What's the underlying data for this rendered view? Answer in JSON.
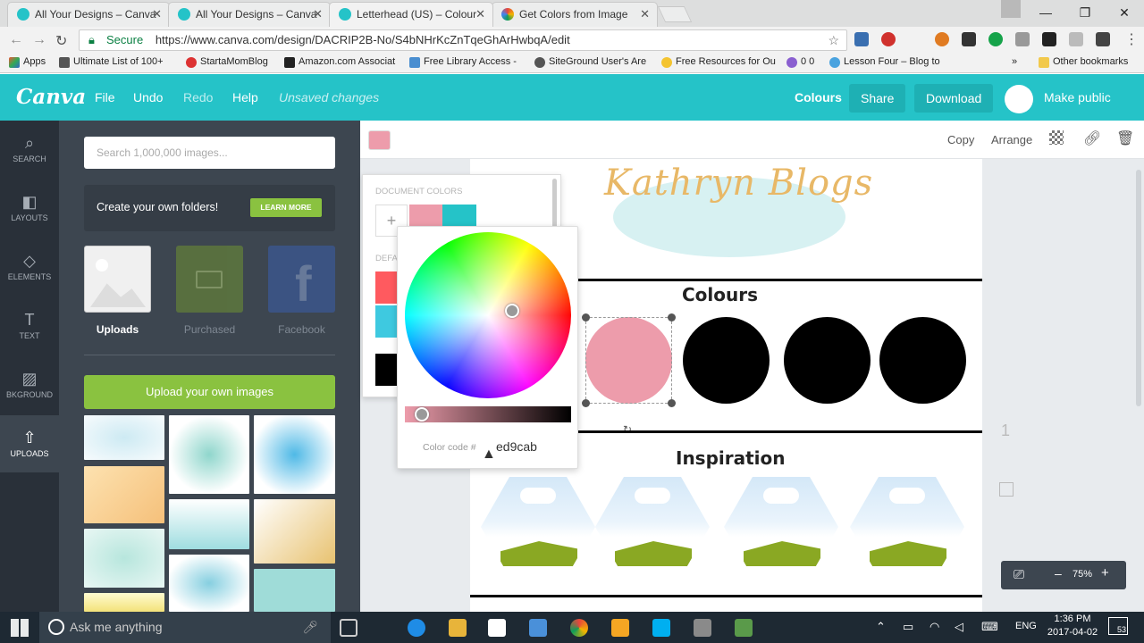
{
  "browser": {
    "tabs": [
      {
        "title": "All Your Designs – Canva",
        "color": "#25c3c8"
      },
      {
        "title": "All Your Designs – Canva",
        "color": "#25c3c8"
      },
      {
        "title": "Letterhead (US) – Colour",
        "color": "#25c3c8"
      },
      {
        "title": "Get Colors from Image",
        "color": "#e8453c"
      }
    ],
    "secure_label": "Secure",
    "url": "https://www.canva.com/design/DACRIP2B-No/S4bNHrKcZnTqeGhArHwbqA/edit",
    "bookmarks": [
      "Apps",
      "Ultimate List of 100+",
      "StartaMomBlog",
      "Amazon.com Associat",
      "Free Library Access -",
      "SiteGround User's Are",
      "Free Resources for Ou",
      "0 0",
      "Lesson Four – Blog to",
      "Other bookmarks"
    ]
  },
  "header": {
    "logo": "Canva",
    "menu": [
      "File",
      "Undo",
      "Redo",
      "Help"
    ],
    "status": "Unsaved changes",
    "colours": "Colours",
    "share": "Share",
    "download": "Download",
    "make_public": "Make public"
  },
  "rail": [
    {
      "label": "SEARCH",
      "icon": "search-icon",
      "glyph": "⌕"
    },
    {
      "label": "LAYOUTS",
      "icon": "layouts-icon",
      "glyph": "◧"
    },
    {
      "label": "ELEMENTS",
      "icon": "elements-icon",
      "glyph": "◇"
    },
    {
      "label": "TEXT",
      "icon": "text-icon",
      "glyph": "T"
    },
    {
      "label": "BKGROUND",
      "icon": "background-icon",
      "glyph": "▨"
    },
    {
      "label": "UPLOADS",
      "icon": "upload-icon",
      "glyph": "⇧"
    }
  ],
  "panel": {
    "search_placeholder": "Search 1,000,000 images...",
    "folder_text": "Create your own folders!",
    "learn_more": "LEARN MORE",
    "tiles": [
      "Uploads",
      "Purchased",
      "Facebook"
    ],
    "upload_button": "Upload your own images"
  },
  "editor": {
    "toolbar": {
      "copy": "Copy",
      "arrange": "Arrange"
    },
    "script_title": "Kathryn Blogs",
    "colours_heading": "Colours",
    "inspiration_heading": "Inspiration",
    "page_number": "1",
    "zoom": "75%"
  },
  "color_panel": {
    "document_colors_label": "DOCUMENT COLORS",
    "default_label": "DEFA",
    "document_colors": [
      "#ed9cab",
      "#25c3c8"
    ],
    "color_code_label": "Color code #",
    "color_code": "ed9cab"
  },
  "taskbar": {
    "search_placeholder": "Ask me anything",
    "language": "ENG",
    "time": "1:36 PM",
    "date": "2017-04-02",
    "notifications": "53"
  }
}
